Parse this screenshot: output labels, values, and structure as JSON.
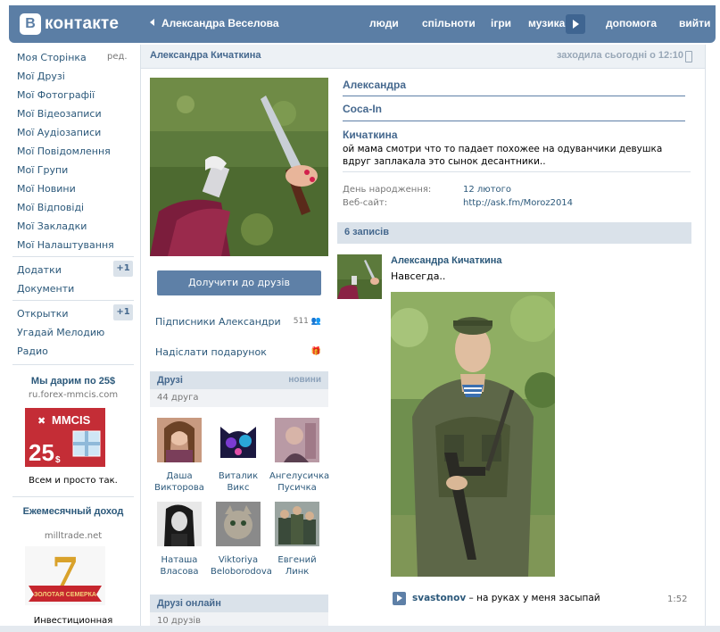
{
  "header": {
    "logo_mark": "В",
    "logo_text": "контакте",
    "current_user": "Александра Веселова",
    "nav": [
      "люди",
      "спільноти",
      "ігри",
      "музика",
      "допомога",
      "вийти"
    ]
  },
  "left_menu": {
    "edit_label": "ред.",
    "items": [
      "Моя Сторінка",
      "Мої Друзі",
      "Мої Фотографії",
      "Мої Відеозаписи",
      "Мої Аудіозаписи",
      "Мої Повідомлення",
      "Мої Групи",
      "Мої Новини",
      "Мої Відповіді",
      "Мої Закладки",
      "Мої Налаштування"
    ],
    "apps": [
      "Додатки",
      "Документи"
    ],
    "apps_badge": "+1",
    "games": [
      "Открытки",
      "Угадай Мелодию",
      "Радио"
    ],
    "games_badge": "+1"
  },
  "ads": {
    "ad1": {
      "title": "Мы дарим по 25$",
      "domain": "ru.forex-mmcis.com",
      "image_text": "MMCIS",
      "image_number": "25",
      "image_currency": "$",
      "text": "Всем и просто так."
    },
    "ad2": {
      "title": "Ежемесячный доход",
      "domain": "milltrade.net",
      "image_number": "7",
      "image_ribbon": "ЗОЛОТАЯ СЕМЕРКА",
      "text": "Инвестиционная"
    }
  },
  "profile": {
    "header_name": "Александра Кичаткина",
    "last_seen": "заходила сьогодні о 12:10",
    "name_line1": "Александра",
    "name_line2": "Coca-In",
    "name_line3": "Кичаткина",
    "status": "ой мама смотри что то падает похожее на одуванчики девушка вдруг заплакала это сынок десантники..",
    "info": [
      {
        "label": "День народження:",
        "value": "12 лютого"
      },
      {
        "label": "Веб-сайт:",
        "value": "http://ask.fm/Moroz2014"
      }
    ],
    "add_friend_label": "Долучити до друзів",
    "followers_label": "Підписники Александри",
    "followers_count": "511",
    "gift_label": "Надіслати подарунок"
  },
  "friends": {
    "title": "Друзі",
    "new_label": "новини",
    "count_label": "44 друга",
    "list": [
      {
        "first": "Даша",
        "last": "Викторова"
      },
      {
        "first": "Виталик",
        "last": "Викс"
      },
      {
        "first": "Ангелусичка",
        "last": "Пусичка"
      },
      {
        "first": "Наташа",
        "last": "Власова"
      },
      {
        "first": "Viktoriya",
        "last": "Beloborodova"
      },
      {
        "first": "Евгений",
        "last": "Линк"
      }
    ],
    "online_title": "Друзі онлайн",
    "online_count": "10 друзів"
  },
  "wall": {
    "posts_count": "6 записів",
    "post": {
      "author": "Александра Кичаткина",
      "text": "Навсегда..",
      "audio_artist": "svastonov",
      "audio_title": " – на руках у меня засыпай",
      "audio_duration": "1:52"
    }
  },
  "colors": {
    "header_blue": "#5b7ea5",
    "link_blue": "#2b587a",
    "section_bg": "#dae2ea",
    "button_blue": "#5e80a7"
  }
}
